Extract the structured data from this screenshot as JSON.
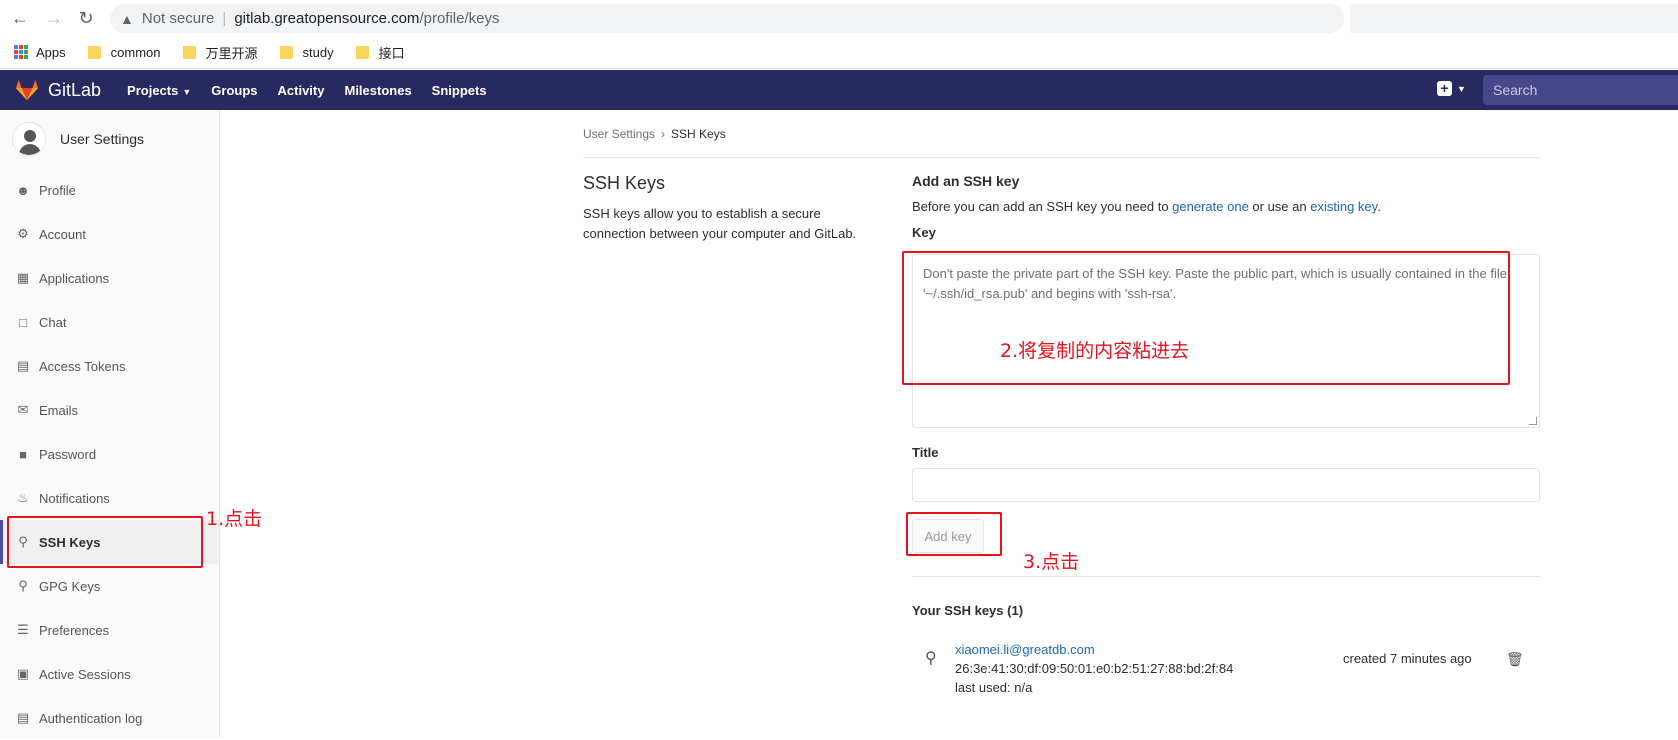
{
  "browser": {
    "security": "Not secure",
    "url_host": "gitlab.greatopensource.com",
    "url_path": "/profile/keys",
    "bookmarks": [
      "Apps",
      "common",
      "万里开源",
      "study",
      "接口"
    ]
  },
  "header": {
    "brand": "GitLab",
    "nav": [
      "Projects",
      "Groups",
      "Activity",
      "Milestones",
      "Snippets"
    ],
    "search_placeholder": "Search"
  },
  "sidebar": {
    "title": "User Settings",
    "items": [
      {
        "label": "Profile",
        "icon": "profile-icon"
      },
      {
        "label": "Account",
        "icon": "account-icon"
      },
      {
        "label": "Applications",
        "icon": "applications-icon"
      },
      {
        "label": "Chat",
        "icon": "chat-icon"
      },
      {
        "label": "Access Tokens",
        "icon": "token-icon"
      },
      {
        "label": "Emails",
        "icon": "mail-icon"
      },
      {
        "label": "Password",
        "icon": "lock-icon"
      },
      {
        "label": "Notifications",
        "icon": "bell-icon"
      },
      {
        "label": "SSH Keys",
        "icon": "key-icon",
        "active": true
      },
      {
        "label": "GPG Keys",
        "icon": "key-icon"
      },
      {
        "label": "Preferences",
        "icon": "sliders-icon"
      },
      {
        "label": "Active Sessions",
        "icon": "monitor-icon"
      },
      {
        "label": "Authentication log",
        "icon": "log-icon"
      }
    ]
  },
  "breadcrumb": {
    "parent": "User Settings",
    "current": "SSH Keys"
  },
  "intro": {
    "title": "SSH Keys",
    "description": "SSH keys allow you to establish a secure connection between your computer and GitLab."
  },
  "form": {
    "heading": "Add an SSH key",
    "help_pre": "Before you can add an SSH key you need to ",
    "help_link1": "generate one",
    "help_mid": " or use an ",
    "help_link2": "existing key",
    "help_post": ".",
    "key_label": "Key",
    "key_placeholder": "Don't paste the private part of the SSH key. Paste the public part, which is usually contained in the file '~/.ssh/id_rsa.pub' and begins with 'ssh-rsa'.",
    "title_label": "Title",
    "title_value": "",
    "submit_label": "Add key"
  },
  "keys": {
    "heading": "Your SSH keys (1)",
    "list": [
      {
        "title": "xiaomei.li@greatdb.com",
        "fingerprint": "26:3e:41:30:df:09:50:01:e0:b2:51:27:88:bd:2f:84",
        "last_used": "last used: n/a",
        "created": "created 7 minutes ago"
      }
    ]
  },
  "annotations": {
    "step1": "1.点击",
    "step2": "2.将复制的内容粘进去",
    "step3": "3.点击",
    "color": "#e6141e"
  }
}
